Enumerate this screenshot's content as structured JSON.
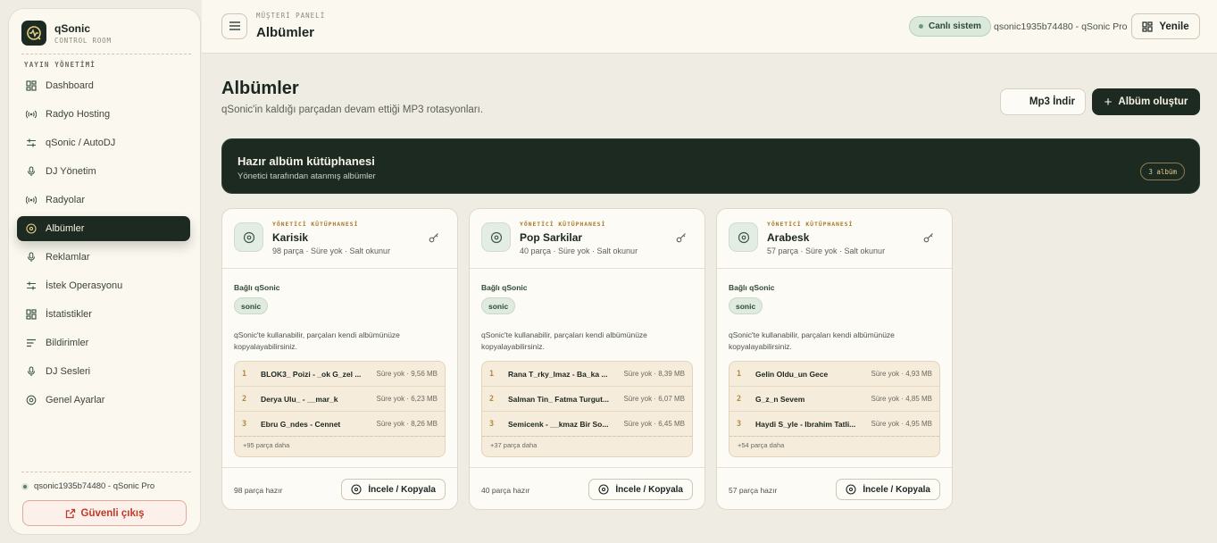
{
  "brand": {
    "name": "qSonic",
    "subtitle": "CONTROL ROOM"
  },
  "sidebar": {
    "section_label": "YAYIN YÖNETİMİ",
    "items": [
      {
        "label": "Dashboard",
        "icon": "grid-icon",
        "active": false
      },
      {
        "label": "Radyo Hosting",
        "icon": "broadcast-icon",
        "active": false
      },
      {
        "label": "qSonic / AutoDJ",
        "icon": "sliders-icon",
        "active": false
      },
      {
        "label": "DJ Yönetim",
        "icon": "microphone-icon",
        "active": false
      },
      {
        "label": "Radyolar",
        "icon": "broadcast-icon",
        "active": false
      },
      {
        "label": "Albümler",
        "icon": "disc-icon",
        "active": true
      },
      {
        "label": "Reklamlar",
        "icon": "microphone-icon",
        "active": false
      },
      {
        "label": "İstek Operasyonu",
        "icon": "sliders-icon",
        "active": false
      },
      {
        "label": "İstatistikler",
        "icon": "grid-icon",
        "active": false
      },
      {
        "label": "Bildirimler",
        "icon": "list-icon",
        "active": false
      },
      {
        "label": "DJ Sesleri",
        "icon": "microphone-icon",
        "active": false
      },
      {
        "label": "Genel Ayarlar",
        "icon": "settings-icon",
        "active": false
      }
    ],
    "user": "qsonic1935b74480 - qSonic Pro",
    "logout_label": "Güvenli çıkış"
  },
  "topbar": {
    "eyebrow": "MÜŞTERİ PANELİ",
    "title": "Albümler",
    "live_badge": "Canlı sistem",
    "account": "qsonic1935b74480 - qSonic Pro",
    "refresh_label": "Yenile"
  },
  "main": {
    "title": "Albümler",
    "subtitle": "qSonic'in kaldığı parçadan devam ettiği MP3 rotasyonları.",
    "mp3_button": "Mp3 İndir",
    "create_button": "Albüm oluştur",
    "banner": {
      "title": "Hazır albüm kütüphanesi",
      "subtitle": "Yönetici tarafından atanmış albümler",
      "badge": "3 albüm"
    }
  },
  "albums": [
    {
      "eyebrow": "YÖNETİCİ KÜTÜPHANESİ",
      "name": "Karisik",
      "meta": "98 parça · Süre yok · Salt okunur",
      "linked_label": "Bağlı qSonic",
      "chip": "sonic",
      "description": "qSonic'te kullanabilir, parçaları kendi albümünüze kopyalayabilirsiniz.",
      "tracks": [
        {
          "num": "1",
          "name": "BLOK3_ Poizi - _ok G_zel ...",
          "info": "Süre yok · 9,56 MB"
        },
        {
          "num": "2",
          "name": "Derya Ulu_ - __mar_k",
          "info": "Süre yok · 6,23 MB"
        },
        {
          "num": "3",
          "name": "Ebru G_ndes - Cennet",
          "info": "Süre yok · 8,26 MB"
        }
      ],
      "more": "+95 parça daha",
      "ready": "98 parça hazır",
      "action": "İncele / Kopyala"
    },
    {
      "eyebrow": "YÖNETİCİ KÜTÜPHANESİ",
      "name": "Pop Sarkilar",
      "meta": "40 parça · Süre yok · Salt okunur",
      "linked_label": "Bağlı qSonic",
      "chip": "sonic",
      "description": "qSonic'te kullanabilir, parçaları kendi albümünüze kopyalayabilirsiniz.",
      "tracks": [
        {
          "num": "1",
          "name": "Rana T_rky_lmaz - Ba_ka ...",
          "info": "Süre yok · 8,39 MB"
        },
        {
          "num": "2",
          "name": "Salman Tin_ Fatma Turgut...",
          "info": "Süre yok · 6,07 MB"
        },
        {
          "num": "3",
          "name": "Semicenk - __kmaz Bir So...",
          "info": "Süre yok · 6,45 MB"
        }
      ],
      "more": "+37 parça daha",
      "ready": "40 parça hazır",
      "action": "İncele / Kopyala"
    },
    {
      "eyebrow": "YÖNETİCİ KÜTÜPHANESİ",
      "name": "Arabesk",
      "meta": "57 parça · Süre yok · Salt okunur",
      "linked_label": "Bağlı qSonic",
      "chip": "sonic",
      "description": "qSonic'te kullanabilir, parçaları kendi albümünüze kopyalayabilirsiniz.",
      "tracks": [
        {
          "num": "1",
          "name": "Gelin Oldu_un Gece",
          "info": "Süre yok · 4,93 MB"
        },
        {
          "num": "2",
          "name": "G_z_n Sevem",
          "info": "Süre yok · 4,85 MB"
        },
        {
          "num": "3",
          "name": "Haydi S_yle - Ibrahim Tatli...",
          "info": "Süre yok · 4,95 MB"
        }
      ],
      "more": "+54 parça daha",
      "ready": "57 parça hazır",
      "action": "İncele / Kopyala"
    }
  ],
  "colors": {
    "accent": "#1d2a22",
    "background": "#efece3",
    "gold": "#a87a2a",
    "danger": "#c0392b"
  }
}
